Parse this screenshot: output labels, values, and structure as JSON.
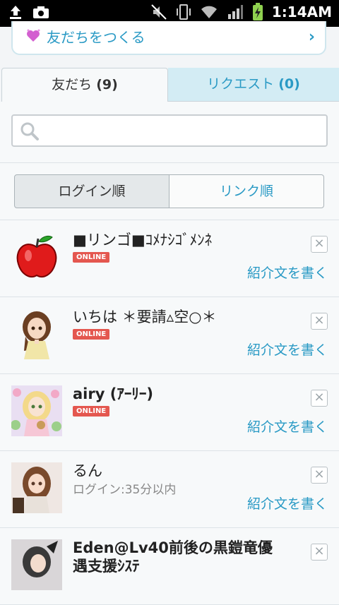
{
  "status_bar": {
    "time": "1:14AM"
  },
  "make_friends": {
    "label": "友だちをつくる"
  },
  "tabs": [
    {
      "label": "友だち",
      "count": "(9)"
    },
    {
      "label": "リクエスト",
      "count": "(0)"
    }
  ],
  "search": {
    "placeholder": ""
  },
  "sort": {
    "login": "ログイン順",
    "link": "リンク順"
  },
  "friends": [
    {
      "name": "■リンゴ■ｺﾒﾅｼｺﾞﾒﾝﾈ",
      "status": "ONLINE",
      "action": "紹介文を書く"
    },
    {
      "name": "いちは ＊要請▵空○＊",
      "status": "ONLINE",
      "action": "紹介文を書く"
    },
    {
      "name": "airy (ｱｰﾘｰ)",
      "status": "ONLINE",
      "action": "紹介文を書く"
    },
    {
      "name": "るん",
      "status": "ログイン:35分以内",
      "action": "紹介文を書く"
    },
    {
      "name": "Eden@Lv40前後の黒鎧竜優",
      "sub": "遇支援ｼｽﾃ",
      "action": ""
    }
  ]
}
